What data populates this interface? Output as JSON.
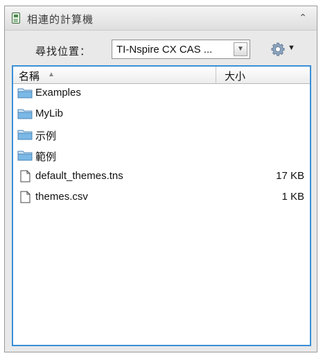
{
  "panel": {
    "title": "相連的計算機",
    "title_icon": "calculator-icon",
    "collapse_icon": "double-chevron-up-icon",
    "collapse_glyph": "⌃"
  },
  "lookin": {
    "label": "尋找位置：",
    "value": "TI-Nspire CX CAS ...",
    "dropdown_glyph": "▼",
    "gear_icon": "gear-icon",
    "gear_caret": "▼"
  },
  "table": {
    "headers": {
      "name": "名稱",
      "size": "大小"
    },
    "sort_glyph": "▲",
    "rows": [
      {
        "name": "Examples",
        "size": "",
        "type": "folder"
      },
      {
        "name": "MyLib",
        "size": "",
        "type": "folder"
      },
      {
        "name": "示例",
        "size": "",
        "type": "folder"
      },
      {
        "name": "範例",
        "size": "",
        "type": "folder"
      },
      {
        "name": "default_themes.tns",
        "size": "17 KB",
        "type": "file"
      },
      {
        "name": "themes.csv",
        "size": "1 KB",
        "type": "file"
      }
    ]
  },
  "colors": {
    "list_border": "#3a8fd8",
    "folder": "#4a9fd8",
    "panel_bg": "#e9e9e9"
  }
}
